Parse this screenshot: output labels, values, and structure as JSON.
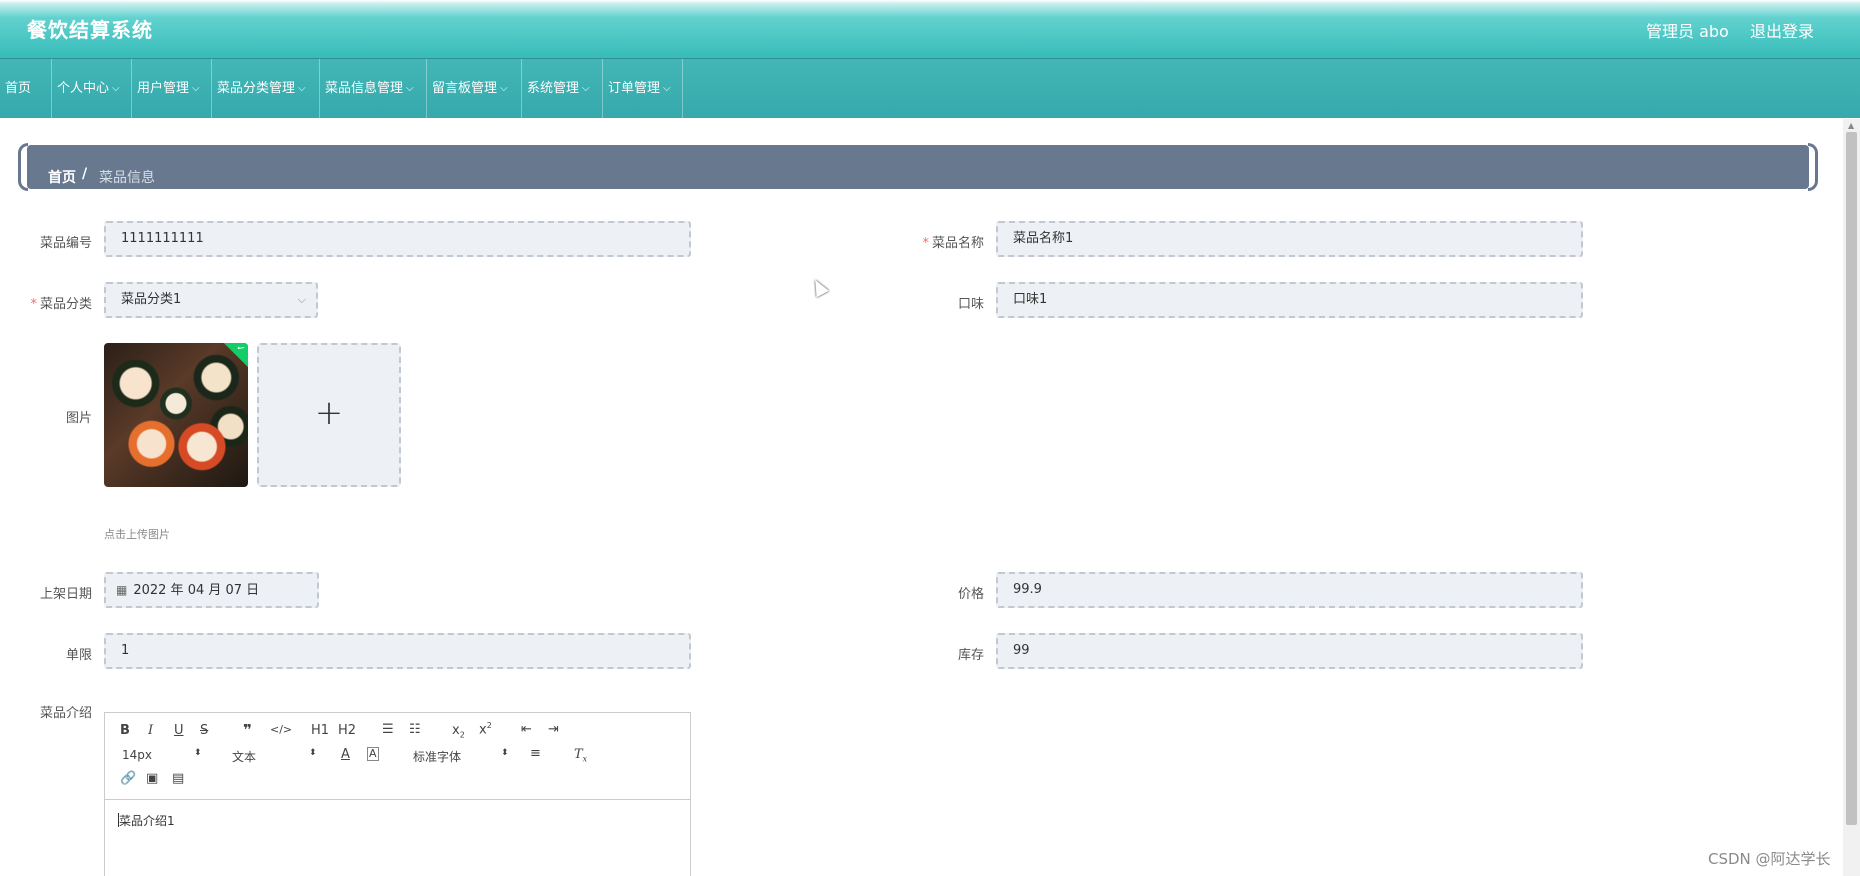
{
  "header": {
    "app_title": "餐饮结算系统",
    "user": "管理员 abo",
    "logout": "退出登录"
  },
  "nav": {
    "items": [
      {
        "label": "首页"
      },
      {
        "label": "个人中心"
      },
      {
        "label": "用户管理"
      },
      {
        "label": "菜品分类管理"
      },
      {
        "label": "菜品信息管理"
      },
      {
        "label": "留言板管理"
      },
      {
        "label": "系统管理"
      },
      {
        "label": "订单管理"
      }
    ]
  },
  "breadcrumb": {
    "home": "首页",
    "separator": "/",
    "current": "菜品信息"
  },
  "form": {
    "dish_no": {
      "label": "菜品编号",
      "value": "1111111111"
    },
    "dish_name": {
      "label": "菜品名称",
      "value": "菜品名称1",
      "required": true
    },
    "category": {
      "label": "菜品分类",
      "value": "菜品分类1",
      "required": true
    },
    "taste": {
      "label": "口味",
      "value": "口味1"
    },
    "image": {
      "label": "图片",
      "tip": "点击上传图片"
    },
    "list_date": {
      "label": "上架日期",
      "value": "2022 年 04 月 07 日"
    },
    "price": {
      "label": "价格",
      "value": "99.9"
    },
    "limit": {
      "label": "单限",
      "value": "1"
    },
    "stock": {
      "label": "库存",
      "value": "99"
    },
    "intro": {
      "label": "菜品介绍",
      "content": "菜品介绍1"
    }
  },
  "editor_toolbar": {
    "font_size": "14px",
    "header": "文本",
    "font_family": "标准字体",
    "h1": "H1",
    "h2": "H2"
  },
  "required_mark": "*",
  "watermark": "CSDN @阿达学长",
  "colors": {
    "header_teal": "#37bcb9",
    "nav_teal": "#36a9ad",
    "breadcrumb_bg": "#67788f",
    "field_bg": "#edf0f4",
    "required_red": "#f56c6c"
  }
}
